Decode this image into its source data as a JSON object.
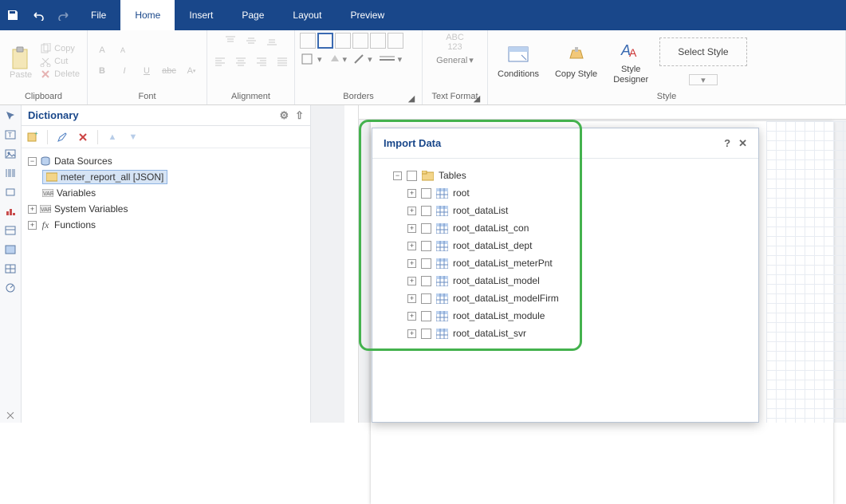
{
  "menu": {
    "file": "File",
    "home": "Home",
    "insert": "Insert",
    "page": "Page",
    "layout": "Layout",
    "preview": "Preview"
  },
  "ribbon": {
    "clipboard": {
      "label": "Clipboard",
      "paste": "Paste",
      "copy": "Copy",
      "cut": "Cut",
      "delete": "Delete"
    },
    "font": {
      "label": "Font"
    },
    "alignment": {
      "label": "Alignment"
    },
    "borders": {
      "label": "Borders"
    },
    "textformat": {
      "label": "Text Format",
      "general": "General",
      "abc123": "ABC\n123"
    },
    "style": {
      "label": "Style",
      "conditions": "Conditions",
      "copystyle": "Copy Style",
      "styledesigner": "Style\nDesigner",
      "selectstyle": "Select Style"
    }
  },
  "dictionary": {
    "title": "Dictionary",
    "tree": {
      "datasources": "Data Sources",
      "meter_report": "meter_report_all [JSON]",
      "variables": "Variables",
      "sysvars": "System Variables",
      "functions": "Functions"
    }
  },
  "dialog": {
    "title": "Import Data",
    "root_label": "Tables",
    "items": [
      "root",
      "root_dataList",
      "root_dataList_con",
      "root_dataList_dept",
      "root_dataList_meterPnt",
      "root_dataList_model",
      "root_dataList_modelFirm",
      "root_dataList_module",
      "root_dataList_svr"
    ]
  }
}
